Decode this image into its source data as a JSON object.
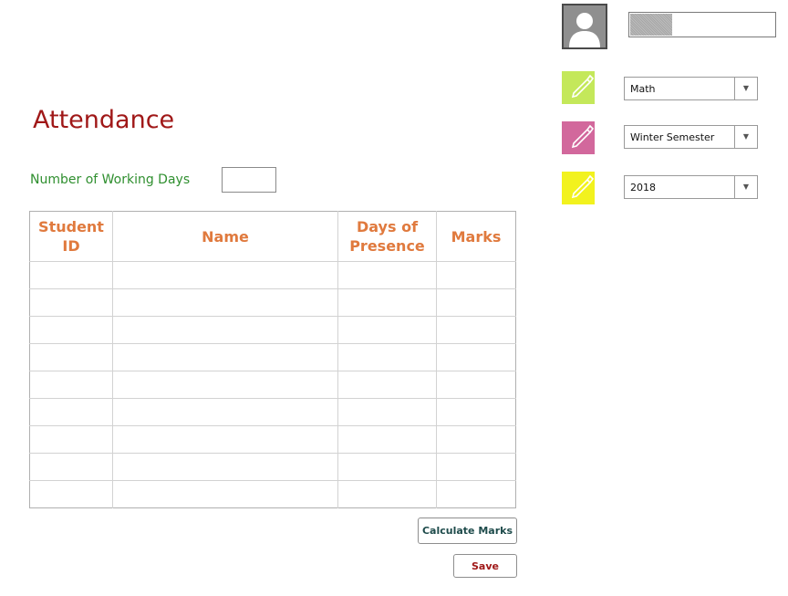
{
  "page": {
    "title": "Attendance"
  },
  "working_days": {
    "label": "Number of Working Days",
    "value": ""
  },
  "table": {
    "headers": [
      {
        "line1": "Student",
        "line2": "ID"
      },
      {
        "line1": "Name",
        "line2": ""
      },
      {
        "line1": "Days of",
        "line2": "Presence"
      },
      {
        "line1": "Marks",
        "line2": ""
      }
    ],
    "rows": [
      [
        "",
        "",
        "",
        ""
      ],
      [
        "",
        "",
        "",
        ""
      ],
      [
        "",
        "",
        "",
        ""
      ],
      [
        "",
        "",
        "",
        ""
      ],
      [
        "",
        "",
        "",
        ""
      ],
      [
        "",
        "",
        "",
        ""
      ],
      [
        "",
        "",
        "",
        ""
      ],
      [
        "",
        "",
        "",
        ""
      ],
      [
        "",
        "",
        "",
        ""
      ]
    ]
  },
  "buttons": {
    "calculate": "Calculate Marks",
    "save": "Save"
  },
  "user": {
    "name": "",
    "avatar_icon": "user-silhouette-icon"
  },
  "filters": {
    "subject": {
      "value": "Math",
      "tile_color": "#c4e85a",
      "icon": "pencil-icon"
    },
    "semester": {
      "value": "Winter Semester",
      "tile_color": "#d2689c",
      "icon": "pencil-icon"
    },
    "year": {
      "value": "2018",
      "tile_color": "#f2f21e",
      "icon": "pencil-icon"
    },
    "dropdown_arrow_icon": "▼"
  },
  "colors": {
    "title": "#a01818",
    "label": "#2f8f2f",
    "header": "#e07a3e"
  }
}
